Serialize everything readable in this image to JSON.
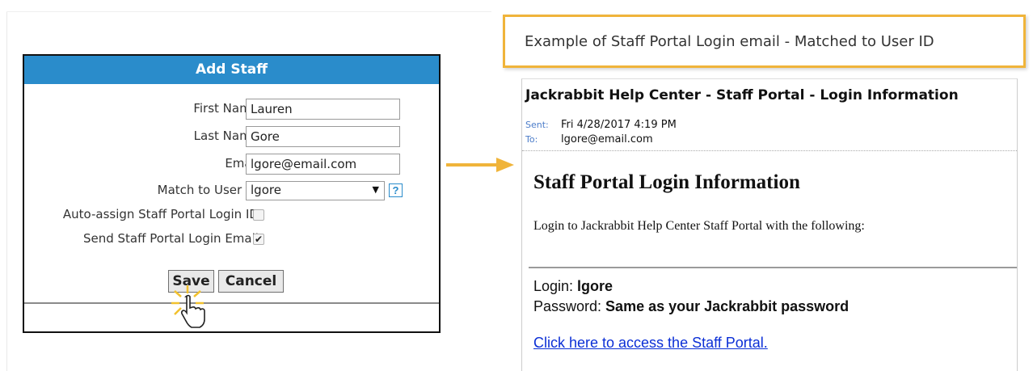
{
  "dialog": {
    "title": "Add Staff",
    "fields": {
      "first_name": {
        "label": "First Name:",
        "value": "Lauren"
      },
      "last_name": {
        "label": "Last Name:",
        "value": "Gore"
      },
      "email": {
        "label": "Email:",
        "value": "lgore@email.com"
      },
      "match_user": {
        "label": "Match to User ID:",
        "value": "lgore",
        "help": "?"
      },
      "auto_assign": {
        "label": "Auto-assign Staff Portal Login ID:",
        "checked": false
      },
      "send_email": {
        "label": "Send Staff Portal Login Email:",
        "checked": true
      }
    },
    "buttons": {
      "save": "Save",
      "cancel": "Cancel"
    }
  },
  "callout": {
    "text": "Example of Staff Portal Login email - Matched to User ID"
  },
  "email": {
    "subject": "Jackrabbit Help Center - Staff Portal - Login Information",
    "sent_label": "Sent:",
    "sent_value": "Fri 4/28/2017 4:19 PM",
    "to_label": "To:",
    "to_value": "lgore@email.com",
    "heading": "Staff Portal Login Information",
    "body": "Login to Jackrabbit Help Center Staff Portal with the following:",
    "login_label": "Login: ",
    "login_value": "lgore",
    "password_label": "Password: ",
    "password_value": "Same as your Jackrabbit password",
    "link_text": "Click here to access the Staff Portal."
  },
  "colors": {
    "accent_blue": "#2a8ccb",
    "callout_border": "#f0b43a",
    "arrow": "#f0b43a",
    "link": "#0b2fd6"
  }
}
